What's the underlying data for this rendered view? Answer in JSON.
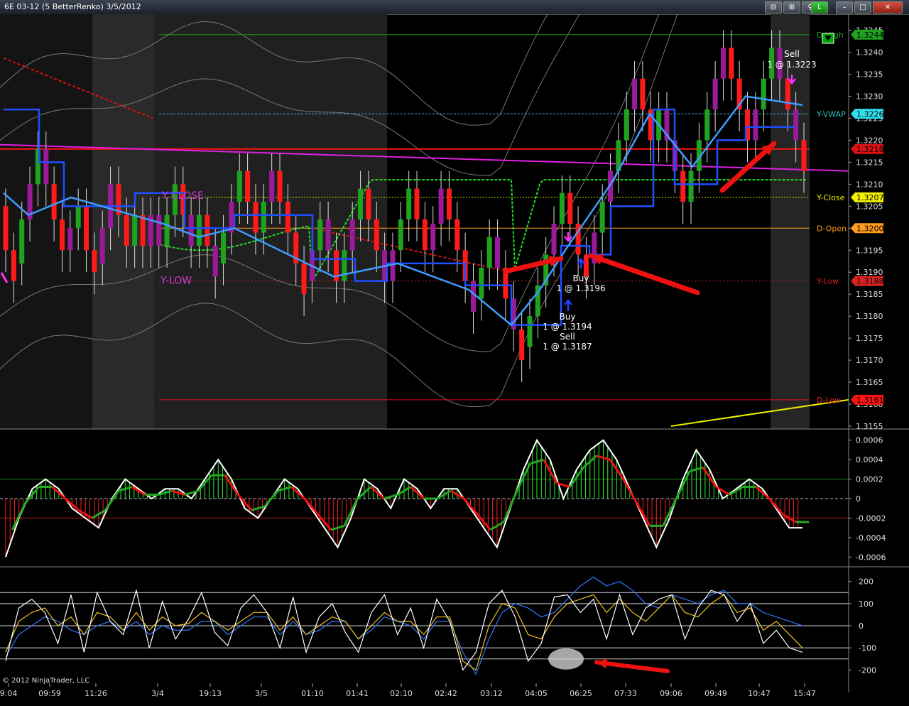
{
  "window": {
    "title": "6E 03-12 (5 BetterRenko)  3/5/2012",
    "buttons": [
      "⊟",
      "⊞",
      "⚲",
      "L",
      "–",
      "□",
      "✕"
    ]
  },
  "copyright": "© 2012 NinjaTrader, LLC",
  "colors": {
    "background": "#000000",
    "bull_bar": "#1fa31f",
    "bear_bar": "#ff1a1a",
    "purple_bar": "#9a1a9a",
    "blue_line": "#1f4fff",
    "light_blue_line": "#3f9cff",
    "magenta_line": "#e020e0",
    "green_dash": "#22dd22",
    "red_dash": "#dd1111",
    "yellow": "#f0f000",
    "orange": "#ff9a1a"
  },
  "chart_data": [
    {
      "type": "candlestick",
      "name": "price",
      "ylim": [
        1.3155,
        1.3248
      ],
      "y_ticks": [
        "1.3155",
        "1.3160",
        "1.3165",
        "1.3170",
        "1.3175",
        "1.3180",
        "1.3185",
        "1.3190",
        "1.3195",
        "1.3200",
        "1.3205",
        "1.3210",
        "1.3215",
        "1.3220",
        "1.3225",
        "1.3230",
        "1.3235",
        "1.3240",
        "1.3245"
      ],
      "x_labels": [
        "9:04",
        "09:59",
        "11:26",
        "3/4",
        "19:13",
        "3/5",
        "01:10",
        "01:41",
        "02:10",
        "02:42",
        "03:12",
        "04:05",
        "06:25",
        "07:33",
        "09:06",
        "09:49",
        "10:47",
        "15:47"
      ],
      "bars": [
        [
          1.3205,
          1.3195
        ],
        [
          1.3195,
          1.3188
        ],
        [
          1.3192,
          1.3202
        ],
        [
          1.3202,
          1.321
        ],
        [
          1.321,
          1.3218
        ],
        [
          1.3218,
          1.321
        ],
        [
          1.321,
          1.3202
        ],
        [
          1.3202,
          1.3195
        ],
        [
          1.3195,
          1.32
        ],
        [
          1.32,
          1.3205
        ],
        [
          1.3205,
          1.3195
        ],
        [
          1.3195,
          1.319
        ],
        [
          1.3192,
          1.32
        ],
        [
          1.32,
          1.321
        ],
        [
          1.321,
          1.3203
        ],
        [
          1.3203,
          1.3196
        ],
        [
          1.3196,
          1.3203
        ],
        [
          1.3203,
          1.3196
        ],
        [
          1.3196,
          1.3203
        ],
        [
          1.3203,
          1.3196
        ],
        [
          1.3196,
          1.3203
        ],
        [
          1.3203,
          1.321
        ],
        [
          1.321,
          1.3203
        ],
        [
          1.3203,
          1.3196
        ],
        [
          1.3196,
          1.3203
        ],
        [
          1.3203,
          1.3196
        ],
        [
          1.3196,
          1.3189
        ],
        [
          1.3192,
          1.3199
        ],
        [
          1.3199,
          1.3206
        ],
        [
          1.3206,
          1.3213
        ],
        [
          1.3213,
          1.3206
        ],
        [
          1.3206,
          1.3199
        ],
        [
          1.3199,
          1.3206
        ],
        [
          1.3206,
          1.3213
        ],
        [
          1.3213,
          1.3206
        ],
        [
          1.3206,
          1.3199
        ],
        [
          1.3199,
          1.3192
        ],
        [
          1.3192,
          1.3185
        ],
        [
          1.3188,
          1.3195
        ],
        [
          1.3195,
          1.3202
        ],
        [
          1.3202,
          1.3195
        ],
        [
          1.3195,
          1.3188
        ],
        [
          1.3188,
          1.3195
        ],
        [
          1.3195,
          1.3202
        ],
        [
          1.3202,
          1.3209
        ],
        [
          1.3209,
          1.3202
        ],
        [
          1.3202,
          1.3195
        ],
        [
          1.3195,
          1.3188
        ],
        [
          1.3188,
          1.3195
        ],
        [
          1.3195,
          1.3202
        ],
        [
          1.3202,
          1.3209
        ],
        [
          1.3209,
          1.3202
        ],
        [
          1.3202,
          1.3195
        ],
        [
          1.3195,
          1.3201
        ],
        [
          1.3201,
          1.3209
        ],
        [
          1.3209,
          1.3202
        ],
        [
          1.3202,
          1.3195
        ],
        [
          1.3195,
          1.3188
        ],
        [
          1.3188,
          1.3181
        ],
        [
          1.3184,
          1.3191
        ],
        [
          1.3191,
          1.3198
        ],
        [
          1.3198,
          1.3191
        ],
        [
          1.3191,
          1.3184
        ],
        [
          1.3184,
          1.3177
        ],
        [
          1.3177,
          1.317
        ],
        [
          1.3173,
          1.318
        ],
        [
          1.318,
          1.3187
        ],
        [
          1.3187,
          1.3194
        ],
        [
          1.3194,
          1.3201
        ],
        [
          1.3201,
          1.3208
        ],
        [
          1.3208,
          1.3201
        ],
        [
          1.3201,
          1.3194
        ],
        [
          1.3194,
          1.3189
        ],
        [
          1.3192,
          1.3199
        ],
        [
          1.3199,
          1.3206
        ],
        [
          1.3206,
          1.3213
        ],
        [
          1.3213,
          1.322
        ],
        [
          1.322,
          1.3227
        ],
        [
          1.3227,
          1.3234
        ],
        [
          1.3234,
          1.3227
        ],
        [
          1.3227,
          1.322
        ],
        [
          1.322,
          1.3227
        ],
        [
          1.3227,
          1.322
        ],
        [
          1.322,
          1.3213
        ],
        [
          1.3213,
          1.3206
        ],
        [
          1.3206,
          1.3213
        ],
        [
          1.3213,
          1.322
        ],
        [
          1.322,
          1.3227
        ],
        [
          1.3227,
          1.3234
        ],
        [
          1.3234,
          1.3241
        ],
        [
          1.3241,
          1.3234
        ],
        [
          1.3234,
          1.3227
        ],
        [
          1.3227,
          1.322
        ],
        [
          1.322,
          1.3227
        ],
        [
          1.3227,
          1.3234
        ],
        [
          1.3234,
          1.3241
        ],
        [
          1.3241,
          1.3234
        ],
        [
          1.3234,
          1.3227
        ],
        [
          1.3227,
          1.322
        ],
        [
          1.322,
          1.3213
        ]
      ],
      "labels": [
        {
          "text": "D-High",
          "y": 1.3244,
          "color": "#1fa31f"
        },
        {
          "text": "Y-VWAP",
          "y": 1.3226,
          "color": "#30c0c0"
        },
        {
          "text": "Y-Close",
          "y": 1.3207,
          "color": "#f0f000"
        },
        {
          "text": "D-Open",
          "y": 1.32,
          "color": "#ff9a1a"
        },
        {
          "text": "Y-Low",
          "y": 1.3188,
          "color": "#dd2222"
        },
        {
          "text": "D-Low",
          "y": 1.3161,
          "color": "#dd2222"
        }
      ],
      "price_tags": [
        {
          "text": "1.3244",
          "y": 1.3244,
          "color": "#1fa31f"
        },
        {
          "text": "1.3226",
          "y": 1.3226,
          "color": "#30e0f0"
        },
        {
          "text": "1.3218",
          "y": 1.3218,
          "color": "#dd1111"
        },
        {
          "text": "1.3207",
          "y": 1.3207,
          "color": "#f0f000"
        },
        {
          "text": "1.3200",
          "y": 1.32,
          "color": "#ff9a1a"
        },
        {
          "text": "1.3188",
          "y": 1.3188,
          "color": "#dd2222"
        },
        {
          "text": "1.3161",
          "y": 1.3161,
          "color": "#ff1111"
        }
      ],
      "annotations": [
        {
          "text": "Y CLOSE",
          "color": "#d03ad0"
        },
        {
          "text": "Y-LOW",
          "color": "#d03ad0"
        },
        {
          "text": "Sell"
        },
        {
          "text": "1 @ 1.3223"
        },
        {
          "text": "Buy"
        },
        {
          "text": "1 @ 1.3196"
        },
        {
          "text": "Buy"
        },
        {
          "text": "1 @ 1.3194"
        },
        {
          "text": "Sell"
        },
        {
          "text": "1 @ 1.3187"
        }
      ]
    },
    {
      "type": "histogram",
      "name": "oscillator",
      "ylim": [
        -0.0007,
        0.0007
      ],
      "y_ticks": [
        "0.0006",
        "0.0004",
        "0.0002",
        "0",
        "-0.0002",
        "-0.0004",
        "-0.0006"
      ],
      "values": [
        -0.0006,
        -0.0002,
        0.0001,
        0.0002,
        0.0001,
        -0.0001,
        -0.0002,
        -0.0003,
        0.0,
        0.0002,
        0.0001,
        0.0,
        0.0001,
        0.0001,
        0.0,
        0.0002,
        0.0004,
        0.0002,
        -0.0001,
        -0.0002,
        0.0,
        0.0002,
        0.0001,
        -0.0001,
        -0.0003,
        -0.0005,
        -0.0002,
        0.0002,
        0.0001,
        -0.0001,
        0.0002,
        0.0001,
        -0.0001,
        0.0001,
        0.0001,
        -0.0001,
        -0.0003,
        -0.0005,
        -0.0001,
        0.0003,
        0.0006,
        0.0004,
        0.0,
        0.0003,
        0.0005,
        0.0006,
        0.0004,
        0.0001,
        -0.0002,
        -0.0005,
        -0.0002,
        0.0002,
        0.0005,
        0.0003,
        0.0,
        0.0001,
        0.0002,
        0.0001,
        -0.0001,
        -0.0003,
        -0.0003
      ]
    },
    {
      "type": "line",
      "name": "cci",
      "ylim": [
        -260,
        260
      ],
      "y_ticks": [
        "200",
        "100",
        "0",
        "-100",
        "-200"
      ],
      "series": [
        {
          "color": "#ffffff",
          "values": [
            -160,
            80,
            120,
            60,
            -80,
            140,
            -120,
            150,
            20,
            -40,
            160,
            -100,
            110,
            -60,
            30,
            150,
            -30,
            -90,
            80,
            140,
            60,
            -100,
            130,
            -120,
            40,
            100,
            -30,
            -120,
            60,
            140,
            -40,
            80,
            -100,
            120,
            20,
            -200,
            -120,
            100,
            160,
            40,
            -160,
            -80,
            130,
            140,
            60,
            120,
            -60,
            140,
            -40,
            80,
            120,
            140,
            -60,
            80,
            160,
            140,
            20,
            100,
            -80,
            -20,
            -100,
            -120
          ]
        },
        {
          "color": "#f0c020",
          "values": [
            -120,
            20,
            60,
            80,
            0,
            40,
            -40,
            60,
            40,
            -20,
            60,
            -20,
            40,
            0,
            10,
            60,
            20,
            -20,
            20,
            60,
            60,
            -20,
            40,
            -40,
            0,
            40,
            20,
            -60,
            0,
            60,
            20,
            20,
            -40,
            40,
            40,
            -160,
            -200,
            0,
            100,
            80,
            -40,
            -60,
            40,
            100,
            120,
            140,
            60,
            120,
            60,
            20,
            80,
            140,
            60,
            40,
            100,
            140,
            60,
            80,
            -20,
            20,
            -40,
            -100
          ]
        },
        {
          "color": "#2f78ff",
          "values": [
            -140,
            -40,
            0,
            40,
            20,
            -20,
            -40,
            0,
            20,
            -20,
            20,
            -40,
            0,
            -20,
            -20,
            20,
            20,
            -40,
            0,
            40,
            40,
            -40,
            20,
            -40,
            -20,
            20,
            20,
            -60,
            -20,
            40,
            20,
            0,
            -60,
            20,
            20,
            -120,
            -220,
            -60,
            60,
            100,
            80,
            40,
            60,
            120,
            180,
            220,
            180,
            200,
            160,
            100,
            80,
            140,
            120,
            100,
            140,
            160,
            100,
            100,
            60,
            40,
            20,
            0
          ]
        }
      ]
    }
  ]
}
